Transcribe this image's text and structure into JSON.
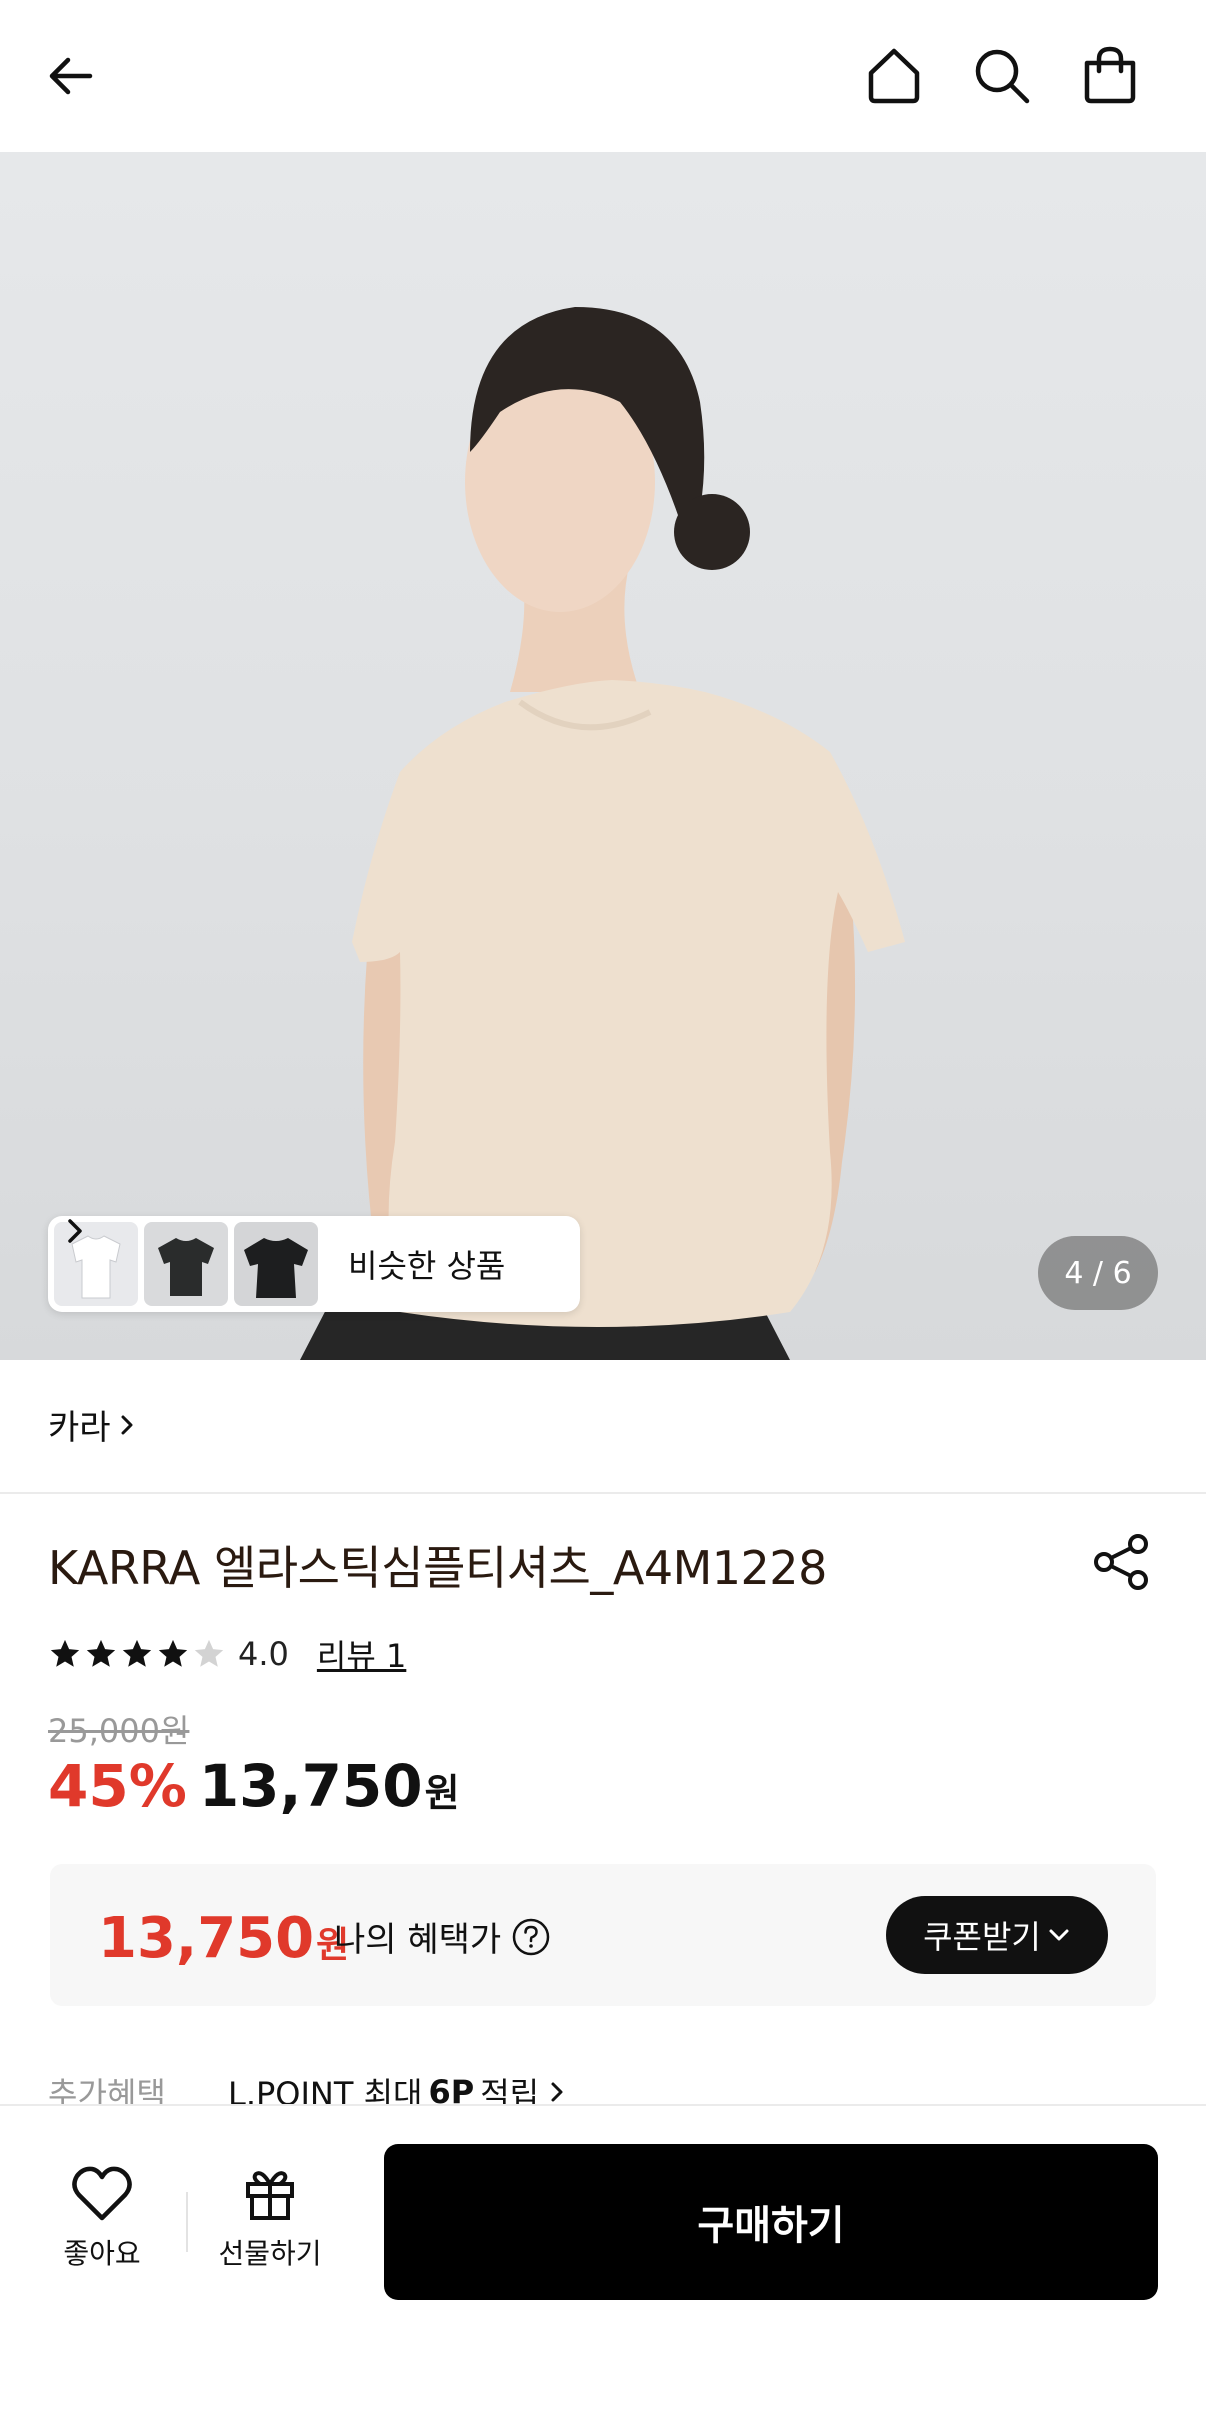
{
  "header": {
    "back_icon": "arrow-left-icon",
    "home_icon": "home-icon",
    "search_icon": "search-icon",
    "bag_icon": "shopping-bag-icon"
  },
  "gallery": {
    "page_indicator": "4 / 6",
    "similar_label": "비슷한 상품"
  },
  "product": {
    "brand": "카라",
    "title": "KARRA 엘라스틱심플티셔츠_A4M1228",
    "rating": 4.0,
    "rating_text": "4.0",
    "review_link": "리뷰 1",
    "original_price": "25,000원",
    "discount": "45%",
    "sale_price": "13,750",
    "sale_unit": "원"
  },
  "benefit": {
    "price": "13,750",
    "unit": "원",
    "label": "나의 혜택가",
    "coupon_button": "쿠폰받기"
  },
  "extra": {
    "label": "추가혜택",
    "text_prefix": "L.POINT 최대",
    "text_bold": "6P",
    "text_suffix": "적립"
  },
  "bottom": {
    "like_label": "좋아요",
    "gift_label": "선물하기",
    "buy_label": "구매하기"
  },
  "colors": {
    "accent_red": "#e0392b",
    "black": "#000000",
    "shirt": "#eee0cf"
  }
}
